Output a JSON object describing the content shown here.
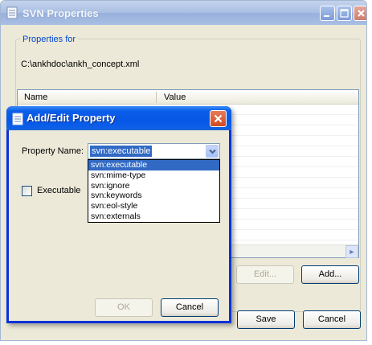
{
  "main_window": {
    "title": "SVN Properties",
    "group_label": "Properties for",
    "path": "C:\\ankhdoc\\ankh_concept.xml",
    "columns": [
      "Name",
      "Value"
    ],
    "buttons": {
      "edit": "Edit...",
      "add": "Add...",
      "save": "Save",
      "cancel": "Cancel"
    }
  },
  "dialog": {
    "title": "Add/Edit Property",
    "property_name_label": "Property Name:",
    "property_name_value": "svn:executable",
    "options": [
      "svn:executable",
      "svn:mime-type",
      "svn:ignore",
      "svn:keywords",
      "svn:eol-style",
      "svn:externals"
    ],
    "selected_option_index": 0,
    "checkbox_label": "Executable",
    "checkbox_checked": false,
    "buttons": {
      "ok": "OK",
      "cancel": "Cancel"
    }
  },
  "colors": {
    "dialog_title_blue": "#0a5ee9",
    "selection": "#316ac5",
    "group_label": "#0046d5",
    "close_red": "#d24a23"
  },
  "icons": {
    "app": "document-icon",
    "minimize": "minimize-icon",
    "maximize": "maximize-icon",
    "close": "close-icon",
    "dropdown": "chevron-down-icon",
    "scroll": "scroll-right-icon"
  }
}
